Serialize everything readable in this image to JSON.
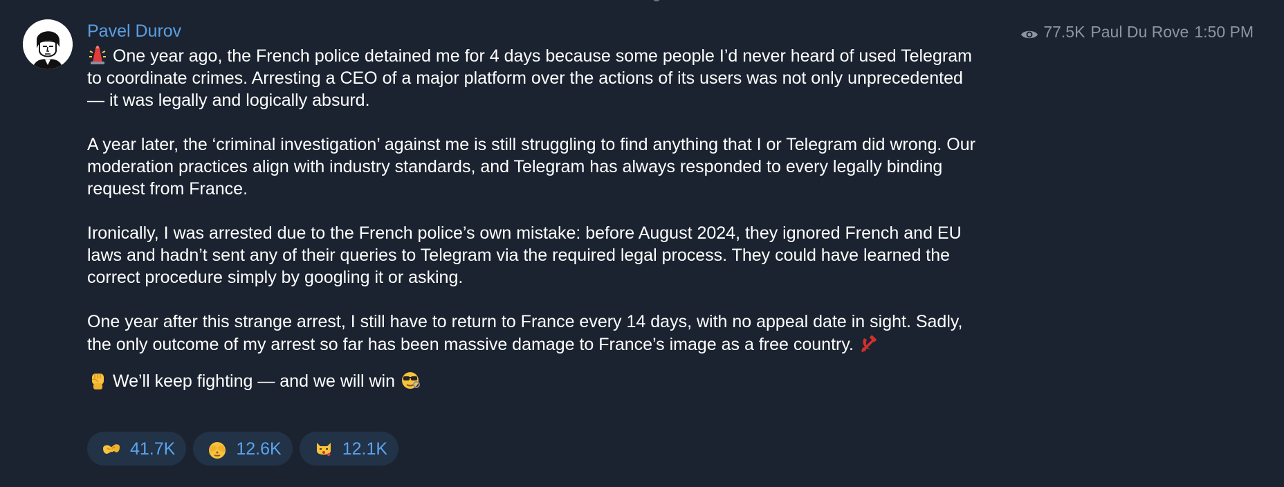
{
  "message": {
    "sender": "Pavel Durov",
    "views": "77.5K",
    "author_signature": "Paul Du Rove",
    "time": "1:50 PM",
    "paragraphs": [
      "One year ago, the French police detained me for 4 days because some people I’d never heard of used Telegram to coordinate crimes. Arresting a CEO of a major platform over the actions of its users was not only unprecedented — it was legally and logically absurd.",
      "A year later, the ‘criminal investigation’ against me is still struggling to find anything that I or Telegram did wrong. Our moderation practices align with industry standards, and Telegram has always responded to every legally binding request from France.",
      "Ironically, I was arrested due to the French police’s own mistake: before August 2024, they ignored French and EU laws and hadn’t sent any of their queries to Telegram via the required legal process. They could have learned the correct procedure simply by googling it or asking.",
      "One year after this strange arrest, I still have to return to France every 14 days, with no appeal date in sight. Sadly, the only outcome of my arrest so far has been massive damage to France’s image as a free country.",
      "We’ll keep fighting — and we will win"
    ],
    "inline_emojis": [
      "police-car-light-emoji",
      "hammer-and-sickle-emoji",
      "raised-fist-emoji",
      "sunglasses-face-emoji"
    ]
  },
  "reactions": [
    {
      "emoji": "hugging-hands-emoji",
      "count": "41.7K"
    },
    {
      "emoji": "see-no-evil-emoji",
      "count": "12.6K"
    },
    {
      "emoji": "kissing-cat-emoji",
      "count": "12.1K"
    }
  ],
  "colors": {
    "background": "#1b2330",
    "sender_name": "#5b9fe3",
    "meta_text": "#8c96a3",
    "reaction_bg": "#223247",
    "reaction_count": "#5ba3ee"
  }
}
